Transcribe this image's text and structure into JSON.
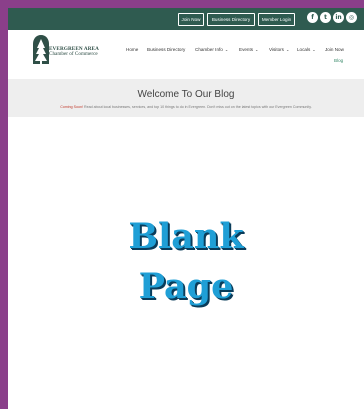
{
  "topbar": {
    "buttons": [
      "Join Now",
      "Business Directory",
      "Member Login"
    ],
    "social_icons": [
      "facebook-icon",
      "twitter-icon",
      "linkedin-icon",
      "instagram-icon"
    ]
  },
  "logo": {
    "line1": "EVERGREEN AREA",
    "line2": "Chamber of Commerce"
  },
  "nav": {
    "items": [
      "Home",
      "Business Directory",
      "Chamber Info",
      "Events",
      "Visitors",
      "Locals",
      "Join Now"
    ],
    "sub_item": "Blog"
  },
  "hero": {
    "title": "Welcome To Our Blog",
    "highlight": "Coming Soon!",
    "subtitle": " Read about local businesses, services, and top 10 things to do in Evergreen. Don't miss out on the latest topics with our Evergreen Community."
  },
  "placeholder": {
    "line1": "Blank",
    "line2": "Page"
  },
  "colors": {
    "frame": "#8a3f8a",
    "topbar": "#2f5b50",
    "accent_text": "#1f9fd6"
  }
}
